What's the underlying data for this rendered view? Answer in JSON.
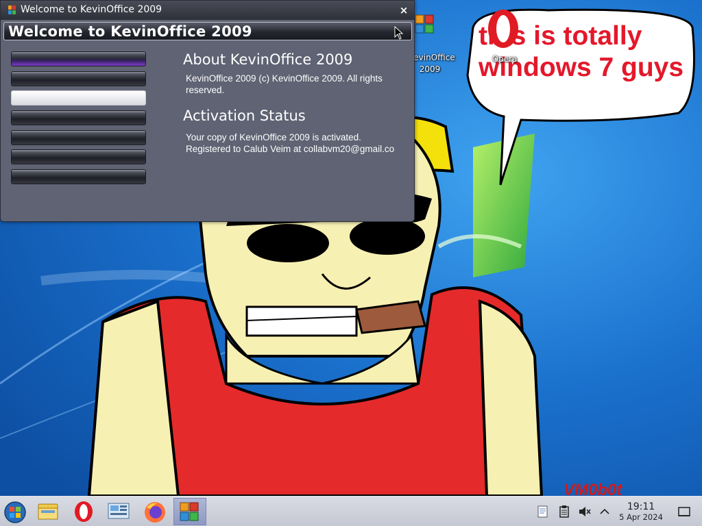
{
  "window": {
    "title": "Welcome to KevinOffice 2009",
    "header": "Welcome to KevinOffice 2009",
    "close_glyph": "×",
    "sidebar_buttons": [
      {
        "label": "",
        "state": "active"
      },
      {
        "label": "",
        "state": "normal"
      },
      {
        "label": "",
        "state": "selected"
      },
      {
        "label": "",
        "state": "normal"
      },
      {
        "label": "",
        "state": "normal"
      },
      {
        "label": "",
        "state": "normal"
      },
      {
        "label": "",
        "state": "normal"
      }
    ],
    "about": {
      "heading": "About KevinOffice 2009",
      "line1": "KevinOffice 2009 (c) KevinOffice 2009. All rights",
      "line2": "reserved."
    },
    "activation": {
      "heading": "Activation Status",
      "line1": "Your copy of KevinOffice 2009 is activated.",
      "line2": "Registered to Calub Veim at collabvm20@gmail.co"
    }
  },
  "desktop": {
    "icons": [
      {
        "name": "KevinOffice 2009",
        "label_line1": "KevinOffice",
        "label_line2": "2009",
        "icon": "office-icon"
      },
      {
        "name": "Opera",
        "label": "Opera",
        "icon": "opera-icon"
      }
    ],
    "bubble_line1": "this is totally",
    "bubble_line2": "windows 7 guys",
    "signature": "VM0b0t"
  },
  "taskbar": {
    "items": [
      "start-orb-icon",
      "file-explorer-icon",
      "opera-icon",
      "control-panel-icon",
      "firefox-icon",
      "kevinoffice-icon"
    ],
    "active_item": "kevinoffice-icon",
    "tray": [
      "notes-icon",
      "clipboard-icon",
      "volume-muted-icon",
      "chevron-up-icon",
      "show-desktop-icon"
    ],
    "clock": {
      "time": "19:11",
      "date": "5 Apr 2024"
    }
  },
  "colors": {
    "wallpaper_blue": "#1a6fc7",
    "window_bg": "#5f6373",
    "bubble_text": "#e3182b",
    "accent_purple": "#7d3cc9"
  }
}
